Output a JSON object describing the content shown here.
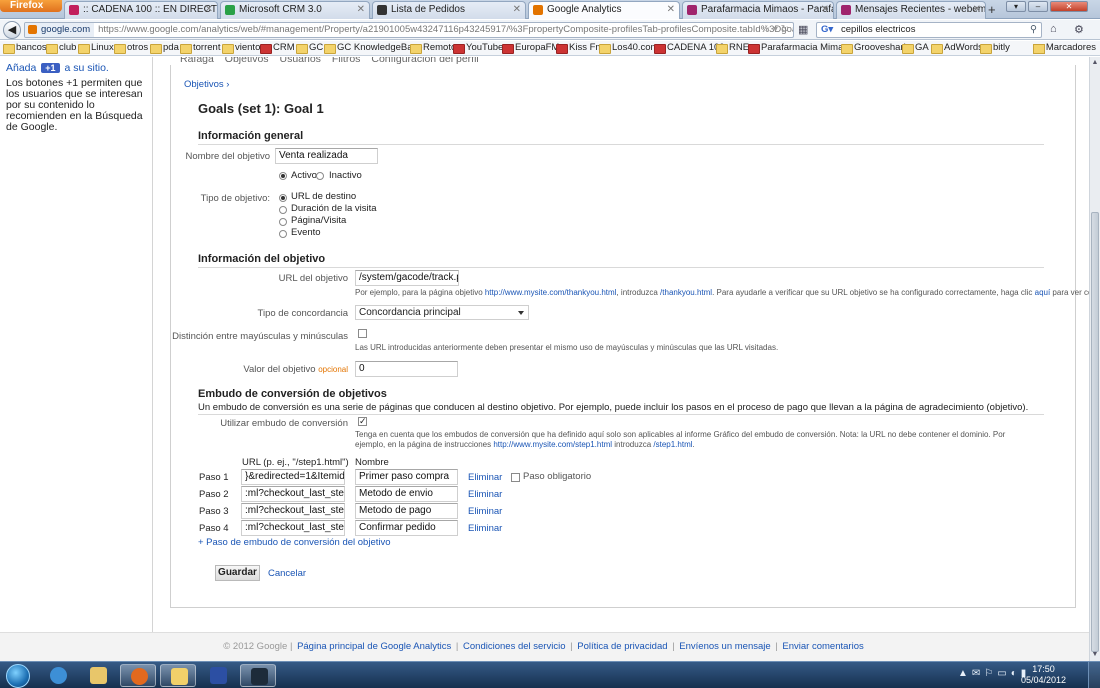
{
  "browser": {
    "app_button": "Firefox",
    "tabs": [
      {
        "title": ":: CADENA 100 :: EN DIRECTO ::",
        "color": "#c21f5c"
      },
      {
        "title": "Microsoft CRM 3.0",
        "color": "#2aa147"
      },
      {
        "title": "Lista de Pedidos",
        "color": "#333333"
      },
      {
        "title": "Google Analytics",
        "color": "#e37400"
      },
      {
        "title": "Parafarmacia Mimaos - Parafarma...",
        "color": "#a0246c"
      },
      {
        "title": "Mensajes Recientes - webempresa...",
        "color": "#a0246c"
      }
    ],
    "url_site": "google.com",
    "url_rest": "https://www.google.com/analytics/web/#management/Property/a21901005w43247116p43245917/%3FpropertyComposite-profilesTab-profilesComposite.tabId%3DgoalsTab/",
    "search_value": "cepillos electricos",
    "bookmarks": [
      "bancos",
      "club",
      "Linux",
      "otros",
      "pda",
      "torrent",
      "viento",
      "CRM",
      "GC",
      "GC KnowledgeBase",
      "Remoto",
      "YouTube",
      "EuropaFM",
      "Kiss Fm",
      "Los40.com",
      "CADENA 100",
      "RNE",
      "Parafarmacia Mimaos",
      "Grooveshark",
      "GA",
      "AdWords",
      "bitly"
    ],
    "bookmarks_more": "Marcadores"
  },
  "left": {
    "plus1_prefix": "Añada",
    "plus1_badge": "+1",
    "plus1_suffix": "a su sitio.",
    "plus1_desc": "Los botones +1 permiten que los usuarios que se interesan por su contenido lo recomienden en la Búsqueda de Google."
  },
  "tabs_cut": [
    "Ráfaga",
    "Objetivos",
    "Usuarios",
    "Filtros",
    "Configuración del perfil"
  ],
  "breadcrumb": "Objetivos ›",
  "goal_title": "Goals (set 1): Goal 1",
  "general": {
    "heading": "Información general",
    "name_label": "Nombre del objetivo",
    "name_value": "Venta realizada",
    "active_label": "Activo",
    "inactive_label": "Inactivo",
    "type_label": "Tipo de objetivo:",
    "types": [
      "URL de destino",
      "Duración de la visita",
      "Página/Visita",
      "Evento"
    ]
  },
  "objective": {
    "heading": "Información del objetivo",
    "url_label": "URL del objetivo",
    "url_value": "/system/gacode/track.php",
    "url_help_1": "Por ejemplo, para la página objetivo ",
    "url_help_link1": "http://www.mysite.com/thankyou.html",
    "url_help_2": ", introduzca ",
    "url_help_link2": "/thankyou.html",
    "url_help_3": ". Para ayudarle a verificar que su URL objetivo se ha configurado correctamente, haga clic ",
    "url_help_link3": "aquí",
    "url_help_4": " para ver consejos.",
    "match_label": "Tipo de concordancia",
    "match_value": "Concordancia principal",
    "case_label": "Distinción entre mayúsculas y minúsculas",
    "case_help": "Las URL introducidas anteriormente deben presentar el mismo uso de mayúsculas y minúsculas que las URL visitadas.",
    "value_label": "Valor del objetivo",
    "value_optional": "opcional",
    "value_value": "0"
  },
  "funnel": {
    "heading": "Embudo de conversión de objetivos",
    "description": "Un embudo de conversión es una serie de páginas que conducen al destino objetivo. Por ejemplo, puede incluir los pasos en el proceso de pago que llevan a la página de agradecimiento (objetivo).",
    "use_label": "Utilizar embudo de conversión",
    "use_help_1": "Tenga en cuenta que los embudos de conversión que ha definido aquí solo son aplicables al informe Gráfico del embudo de conversión. Nota: la URL no debe contener el dominio. Por ejemplo, en la página de instrucciones ",
    "use_help_link1": "http://www.mysite.com/step1.html",
    "use_help_2": " introduzca ",
    "use_help_link2": "/step1.html",
    "use_help_3": ".",
    "col_url": "URL (p. ej., \"/step1.html\")",
    "col_name": "Nombre",
    "steps": [
      {
        "label": "Paso 1",
        "url": "}&redirected=1&Itemid=70",
        "name": "Primer paso compra"
      },
      {
        "label": "Paso 2",
        "url": ":ml?checkout_last_step=1",
        "name": "Metodo de envio"
      },
      {
        "label": "Paso 3",
        "url": ":ml?checkout_last_step=2",
        "name": "Metodo de pago"
      },
      {
        "label": "Paso 4",
        "url": ":ml?checkout_last_step=3",
        "name": "Confirmar pedido"
      }
    ],
    "remove_label": "Eliminar",
    "required_label": "Paso obligatorio",
    "add_step": "+ Paso de embudo de conversión del objetivo"
  },
  "actions": {
    "save": "Guardar",
    "cancel": "Cancelar"
  },
  "footer": {
    "copyright": "© 2012 Google",
    "links": [
      "Página principal de Google Analytics",
      "Condiciones del servicio",
      "Política de privacidad",
      "Envíenos un mensaje",
      "Enviar comentarios"
    ]
  },
  "taskbar": {
    "time": "17:50",
    "date": "05/04/2012"
  }
}
